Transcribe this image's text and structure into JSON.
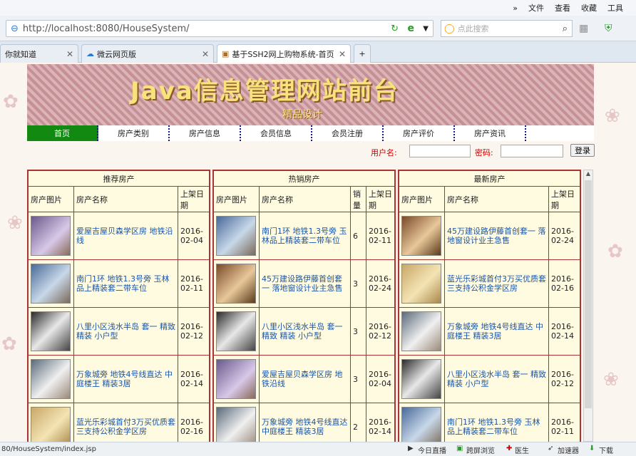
{
  "browser": {
    "menu": [
      "»",
      "文件",
      "查看",
      "收藏",
      "工具"
    ],
    "url": "http://localhost:8080/HouseSystem/",
    "search_placeholder": "点此搜索",
    "tabs": [
      "你就知道",
      "微云网页版",
      "基于SSH2网上购物系统-首页"
    ],
    "new_tab": "+",
    "status_url": "80/HouseSystem/index.jsp",
    "status_items": [
      "今日直播",
      "跨屏浏览",
      "医生",
      "加速器",
      "下载"
    ]
  },
  "site": {
    "title": "Java信息管理网站前台",
    "subtitle": "精品设计",
    "nav": [
      "首页",
      "房产类别",
      "房产信息",
      "会员信息",
      "会员注册",
      "房产评价",
      "房产资讯"
    ],
    "login": {
      "user_label": "用户名:",
      "pwd_label": "密码:",
      "button": "登录"
    }
  },
  "panels": [
    {
      "title": "推荐房产",
      "cols": [
        "房产图片",
        "房产名称",
        "上架日期"
      ],
      "rows": [
        {
          "name": "爱屋吉屋贝森学区房 地铁沿线",
          "date": "2016-02-04"
        },
        {
          "name": "南门1环 地铁1.3号旁 玉林品上精装套二带车位",
          "date": "2016-02-11"
        },
        {
          "name": "八里小区浅水半岛 套一 精致 精装 小户型",
          "date": "2016-02-12"
        },
        {
          "name": "万象城旁 地铁4号线直达 中庭楼王 精装3居",
          "date": "2016-02-14"
        },
        {
          "name": "蓝光乐彩城首付3万买优质套三支持公积金学区房",
          "date": "2016-02-16"
        }
      ]
    },
    {
      "title": "热销房产",
      "cols": [
        "房产图片",
        "房产名称",
        "销量",
        "上架日期"
      ],
      "rows": [
        {
          "name": "南门1环 地铁1.3号旁 玉林品上精装套二带车位",
          "sales": "6",
          "date": "2016-02-11"
        },
        {
          "name": "45万建设路伊藤首创套一 落地窗设计业主急售",
          "sales": "3",
          "date": "2016-02-24"
        },
        {
          "name": "八里小区浅水半岛 套一 精致 精装 小户型",
          "sales": "3",
          "date": "2016-02-12"
        },
        {
          "name": "爱屋吉屋贝森学区房 地铁沿线",
          "sales": "3",
          "date": "2016-02-04"
        },
        {
          "name": "万象城旁 地铁4号线直达 中庭楼王 精装3居",
          "sales": "2",
          "date": "2016-02-14"
        }
      ]
    },
    {
      "title": "最新房产",
      "cols": [
        "房产图片",
        "房产名称",
        "上架日期"
      ],
      "rows": [
        {
          "name": "45万建设路伊藤首创套一 落地窗设计业主急售",
          "date": "2016-02-24"
        },
        {
          "name": "蓝光乐彩城首付3万买优质套三支持公积金学区房",
          "date": "2016-02-16"
        },
        {
          "name": "万象城旁 地铁4号线直达 中庭楼王 精装3居",
          "date": "2016-02-14"
        },
        {
          "name": "八里小区浅水半岛 套一 精致 精装 小户型",
          "date": "2016-02-12"
        },
        {
          "name": "南门1环 地铁1.3号旁 玉林品上精装套二带车位",
          "date": "2016-02-11"
        }
      ]
    }
  ],
  "colors": {
    "nav_active": "#128a12",
    "panel_border": "#aa3333",
    "link": "#1a55a8"
  }
}
